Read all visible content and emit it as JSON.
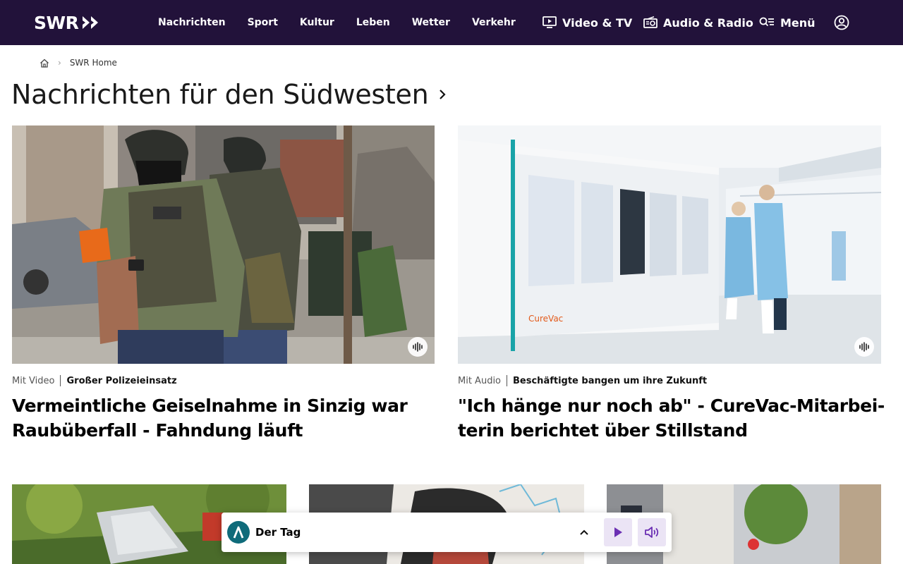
{
  "header": {
    "logo": "SWR",
    "nav": [
      "Nachrichten",
      "Sport",
      "Kultur",
      "Leben",
      "Wetter",
      "Verkehr"
    ],
    "video_tv": "Video & TV",
    "audio_radio": "Audio & Radio",
    "menu": "Menü"
  },
  "breadcrumb": {
    "home_icon": "home-icon",
    "current": "SWR Home"
  },
  "section": {
    "title": "Nachrichten für den Südwesten"
  },
  "teasers": [
    {
      "kind": "Mit Video",
      "kicker": "Großer Polizeieinsatz",
      "headline_1": "Vermeintliche Geiselnahme in Sinzig war",
      "headline_2": "Raubüberfall - Fahndung läuft"
    },
    {
      "kind": "Mit Audio",
      "kicker": "Beschäftigte bangen um ihre Zukunft",
      "headline_1": "\"Ich hänge nur noch ab\" - CureVac-Mitarbei-",
      "headline_2": "terin berichtet über Stillstand",
      "image_logo": "CureVac"
    }
  ],
  "player": {
    "title": "Der Tag"
  },
  "colors": {
    "header_bg": "#22123a",
    "accent_purple": "#6b2fb3",
    "player_button_bg": "#ebe4f5",
    "player_logo_bg": "#0f6b7a"
  }
}
